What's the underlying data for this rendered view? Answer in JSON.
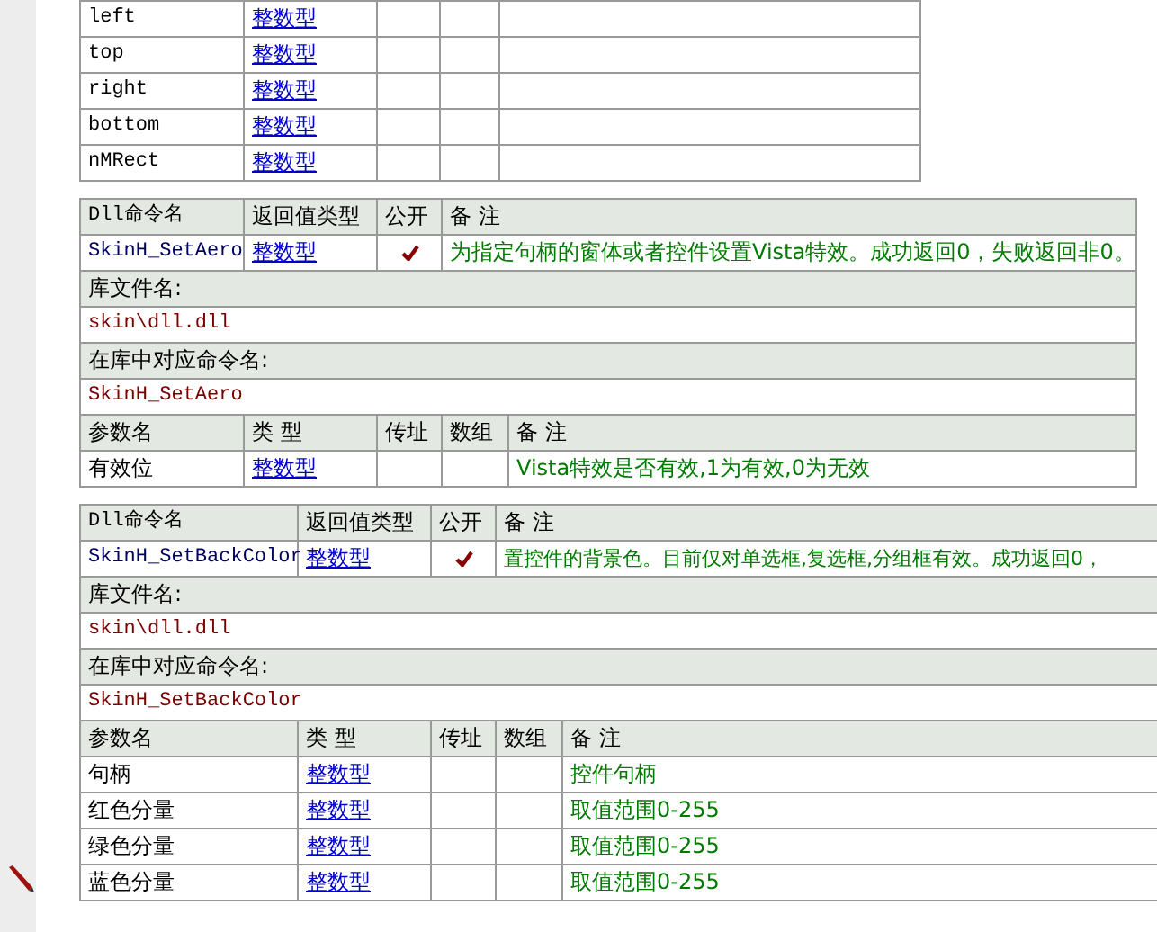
{
  "tables": [
    {
      "kind": "params",
      "rows": [
        {
          "name": "left",
          "type": "整数型"
        },
        {
          "name": "top",
          "type": "整数型"
        },
        {
          "name": "right",
          "type": "整数型"
        },
        {
          "name": "bottom",
          "type": "整数型"
        },
        {
          "name": "nMRect",
          "type": "整数型"
        }
      ]
    },
    {
      "kind": "dll",
      "header": [
        "Dll命令名",
        "返回值类型",
        "公开",
        "备 注"
      ],
      "command": "SkinH_SetAero",
      "return_type": "整数型",
      "public": true,
      "note": "为指定句柄的窗体或者控件设置Vista特效。成功返回0，失败返回非0。",
      "lib_label": "库文件名:",
      "lib": "skin\\dll.dll",
      "entry_label": "在库中对应命令名:",
      "entry": "SkinH_SetAero",
      "param_header": [
        "参数名",
        "类 型",
        "传址",
        "数组",
        "备 注"
      ],
      "params": [
        {
          "name": "有效位",
          "type": "整数型",
          "note": "Vista特效是否有效,1为有效,0为无效"
        }
      ]
    },
    {
      "kind": "dll",
      "header": [
        "Dll命令名",
        "返回值类型",
        "公开",
        "备 注"
      ],
      "command": "SkinH_SetBackColor",
      "return_type": "整数型",
      "public": true,
      "note": "置控件的背景色。目前仅对单选框,复选框,分组框有效。成功返回0，",
      "lib_label": "库文件名:",
      "lib": "skin\\dll.dll",
      "entry_label": "在库中对应命令名:",
      "entry": "SkinH_SetBackColor",
      "param_header": [
        "参数名",
        "类 型",
        "传址",
        "数组",
        "备 注"
      ],
      "params": [
        {
          "name": "句柄",
          "type": "整数型",
          "note": "控件句柄"
        },
        {
          "name": "红色分量",
          "type": "整数型",
          "note": "取值范围0-255"
        },
        {
          "name": "绿色分量",
          "type": "整数型",
          "note": "取值范围0-255"
        },
        {
          "name": "蓝色分量",
          "type": "整数型",
          "note": "取值范围0-255"
        }
      ]
    }
  ]
}
